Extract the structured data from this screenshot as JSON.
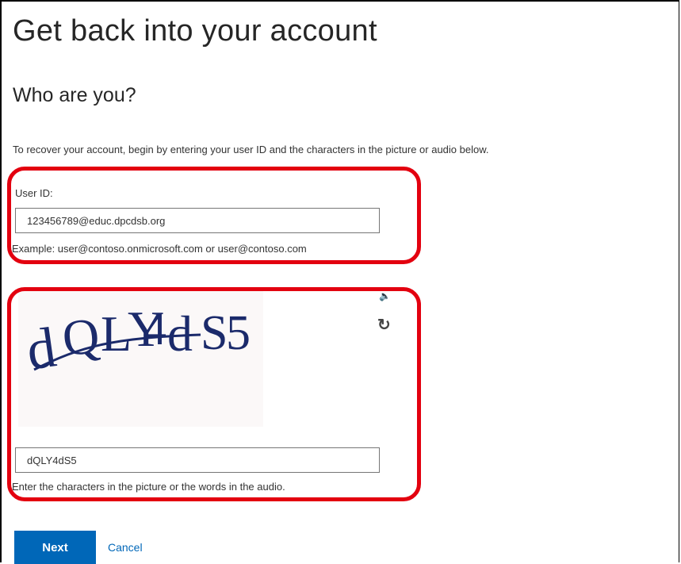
{
  "page": {
    "title": "Get back into your account",
    "subtitle": "Who are you?",
    "intro": "To recover your account, begin by entering your user ID and the characters in the picture or audio below."
  },
  "user_id": {
    "label": "User ID:",
    "value": "123456789@educ.dpcdsb.org",
    "example": "Example: user@contoso.onmicrosoft.com or user@contoso.com"
  },
  "captcha": {
    "image_text": "dQLY4dS5",
    "value": "dQLY4dS5",
    "hint": "Enter the characters in the picture or the words in the audio.",
    "audio_icon": "speaker-icon",
    "refresh_icon": "refresh-icon"
  },
  "actions": {
    "next_label": "Next",
    "cancel_label": "Cancel"
  },
  "colors": {
    "accent": "#0067b8",
    "highlight": "#e3000f",
    "captcha_text": "#1b2a6b"
  }
}
